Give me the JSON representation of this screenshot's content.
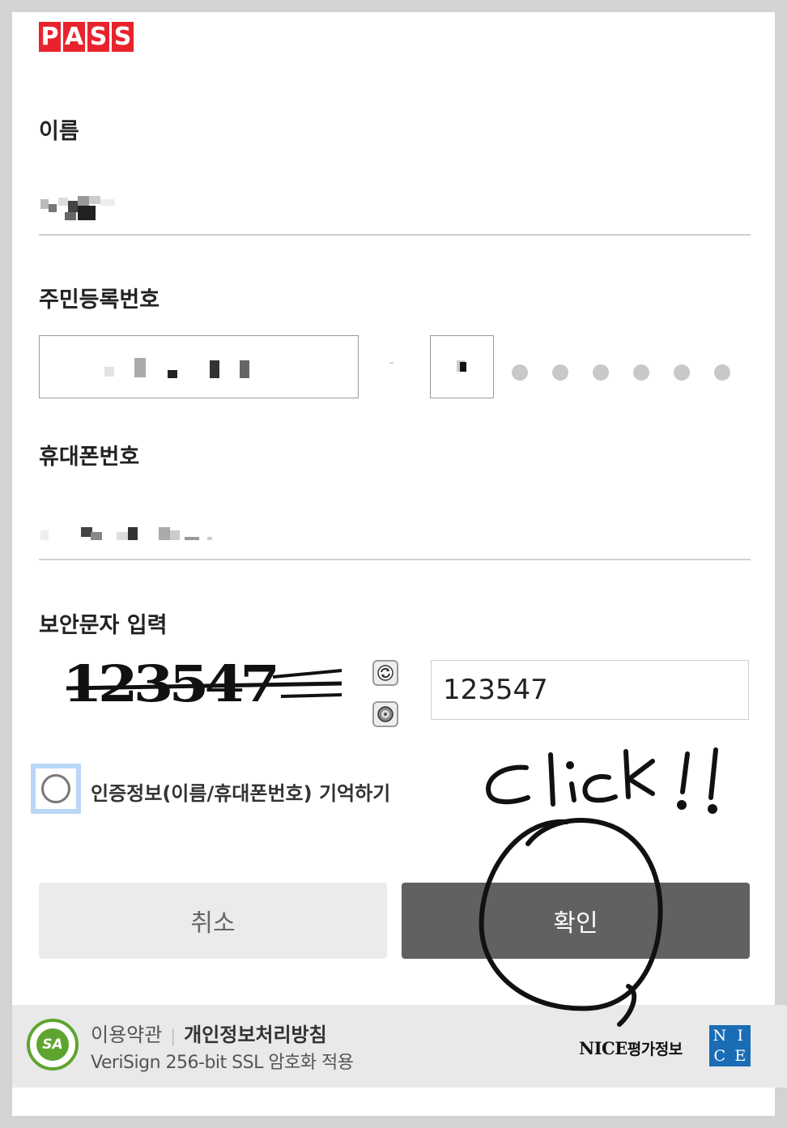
{
  "brand": {
    "logo_letters": [
      "P",
      "A",
      "S",
      "S"
    ],
    "color": "#e8232d"
  },
  "form": {
    "name_label": "이름",
    "ssn_label": "주민등록번호",
    "ssn_separator": "-",
    "ssn_masked_digits": 6,
    "phone_label": "휴대폰번호",
    "captcha_label": "보안문자 입력",
    "captcha_image_text": "123547",
    "captcha_input_value": "123547",
    "captcha_refresh_icon": "refresh-icon",
    "captcha_audio_icon": "audio-icon",
    "remember_label": "인증정보(이름/휴대폰번호) 기억하기",
    "remember_checked": false
  },
  "buttons": {
    "cancel_label": "취소",
    "confirm_label": "확인",
    "confirm_color": "#616161"
  },
  "footer": {
    "terms_link": "이용약관",
    "privacy_link": "개인정보처리방침",
    "ssl_text": "VeriSign 256-bit SSL 암호화 적용",
    "nice_brand": "NICE",
    "nice_brand_kr": "평가정보",
    "nice_logo_letters": [
      "N",
      "I",
      "C",
      "E"
    ]
  },
  "annotation": {
    "text": "click !!"
  }
}
